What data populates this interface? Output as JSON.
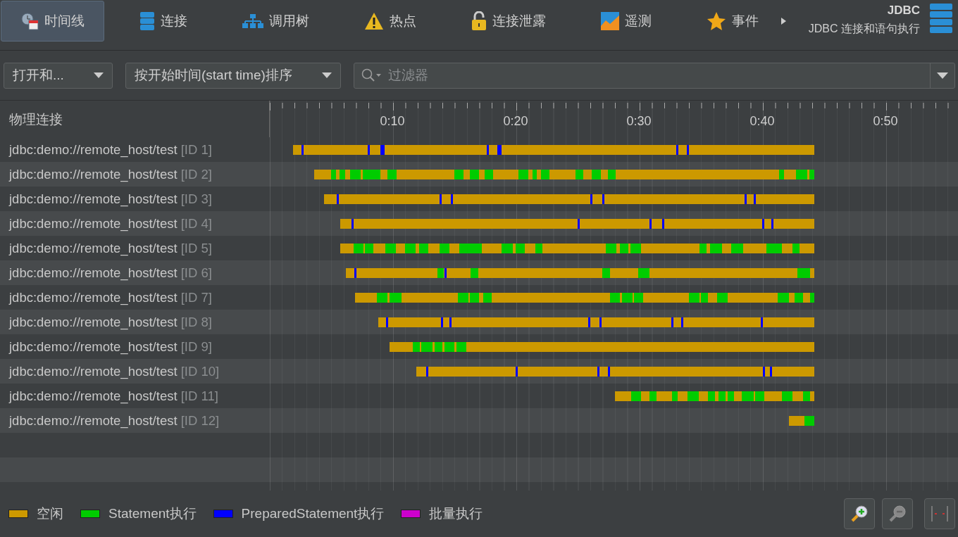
{
  "tabs": [
    {
      "label": "时间线",
      "selected": true
    },
    {
      "label": "连接",
      "selected": false
    },
    {
      "label": "调用树",
      "selected": false
    },
    {
      "label": "热点",
      "selected": false
    },
    {
      "label": "连接泄露",
      "selected": false
    },
    {
      "label": "遥测",
      "selected": false
    },
    {
      "label": "事件",
      "selected": false
    }
  ],
  "header": {
    "title": "JDBC",
    "subtitle": "JDBC 连接和语句执行"
  },
  "toolbar": {
    "view_dropdown": "打开和...",
    "sort_dropdown": "按开始时间(start time)排序",
    "filter": {
      "placeholder": "过滤器"
    }
  },
  "timeline": {
    "column_title": "物理连接",
    "axis_labels": [
      "0:10",
      "0:20",
      "0:30",
      "0:40",
      "0:50"
    ],
    "rows": [
      {
        "name": "jdbc:demo://remote_host/test",
        "id": "[ID 1]"
      },
      {
        "name": "jdbc:demo://remote_host/test",
        "id": "[ID 2]"
      },
      {
        "name": "jdbc:demo://remote_host/test",
        "id": "[ID 3]"
      },
      {
        "name": "jdbc:demo://remote_host/test",
        "id": "[ID 4]"
      },
      {
        "name": "jdbc:demo://remote_host/test",
        "id": "[ID 5]"
      },
      {
        "name": "jdbc:demo://remote_host/test",
        "id": "[ID 6]"
      },
      {
        "name": "jdbc:demo://remote_host/test",
        "id": "[ID 7]"
      },
      {
        "name": "jdbc:demo://remote_host/test",
        "id": "[ID 8]"
      },
      {
        "name": "jdbc:demo://remote_host/test",
        "id": "[ID 9]"
      },
      {
        "name": "jdbc:demo://remote_host/test",
        "id": "[ID 10]"
      },
      {
        "name": "jdbc:demo://remote_host/test",
        "id": "[ID 11]"
      },
      {
        "name": "jdbc:demo://remote_host/test",
        "id": "[ID 12]"
      }
    ]
  },
  "legend": [
    {
      "label": "空闲",
      "color": "#cc9900"
    },
    {
      "label": "Statement执行",
      "color": "#00cc00"
    },
    {
      "label": "PreparedStatement执行",
      "color": "#0000ff"
    },
    {
      "label": "批量执行",
      "color": "#cc00cc"
    }
  ]
}
